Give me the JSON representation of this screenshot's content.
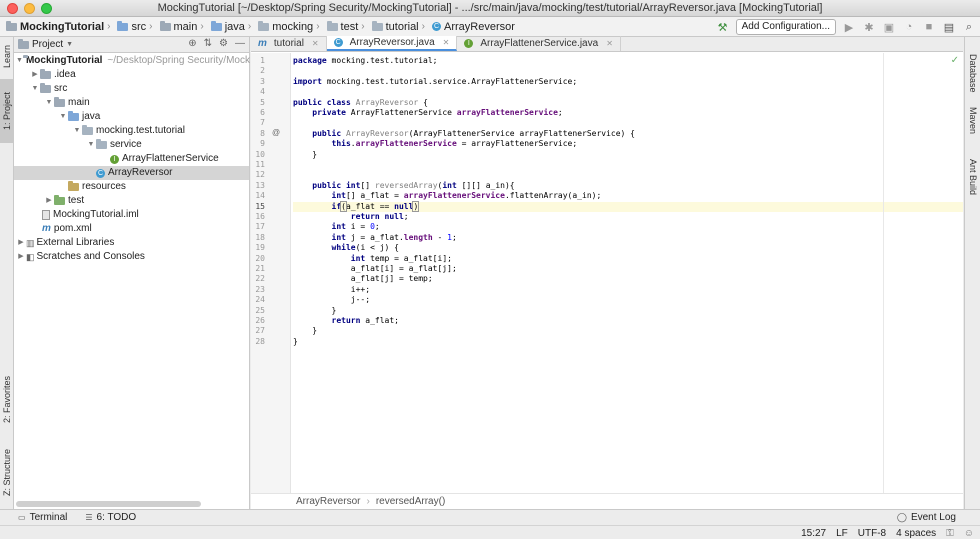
{
  "window": {
    "title": "MockingTutorial [~/Desktop/Spring Security/MockingTutorial] - .../src/main/java/mocking/test/tutorial/ArrayReversor.java [MockingTutorial]"
  },
  "navbar": {
    "crumbs": [
      "MockingTutorial",
      "src",
      "main",
      "java",
      "mocking",
      "test",
      "tutorial",
      "ArrayReversor"
    ],
    "add_config": "Add Configuration..."
  },
  "left_strip": {
    "learn": "Learn",
    "project": "1: Project",
    "favorites": "2: Favorites",
    "structure": "Z: Structure"
  },
  "right_strip": {
    "database": "Database",
    "maven": "Maven",
    "ant": "Ant Build"
  },
  "project_panel": {
    "header": "Project",
    "root": "MockingTutorial",
    "root_path": "~/Desktop/Spring Security/Mock",
    "items": {
      "idea": ".idea",
      "src": "src",
      "main": "main",
      "java": "java",
      "pkg": "mocking.test.tutorial",
      "service": "service",
      "afs": "ArrayFlattenerService",
      "ar": "ArrayReversor",
      "resources": "resources",
      "test": "test",
      "iml": "MockingTutorial.iml",
      "pom": "pom.xml",
      "ext": "External Libraries",
      "scratch": "Scratches and Consoles"
    }
  },
  "editor": {
    "tabs": [
      "tutorial",
      "ArrayReversor.java",
      "ArrayFlattenerService.java"
    ],
    "breadcrumb": [
      "ArrayReversor",
      "reversedArray()"
    ]
  },
  "status": {
    "terminal": "Terminal",
    "todo": "6: TODO",
    "event_log": "Event Log",
    "position": "15:27",
    "line_sep": "LF",
    "encoding": "UTF-8",
    "indent": "4 spaces"
  },
  "colors": {
    "keyword": "#000080",
    "field": "#660e7a",
    "number": "#0000ff",
    "current_line": "#fdfadc"
  }
}
